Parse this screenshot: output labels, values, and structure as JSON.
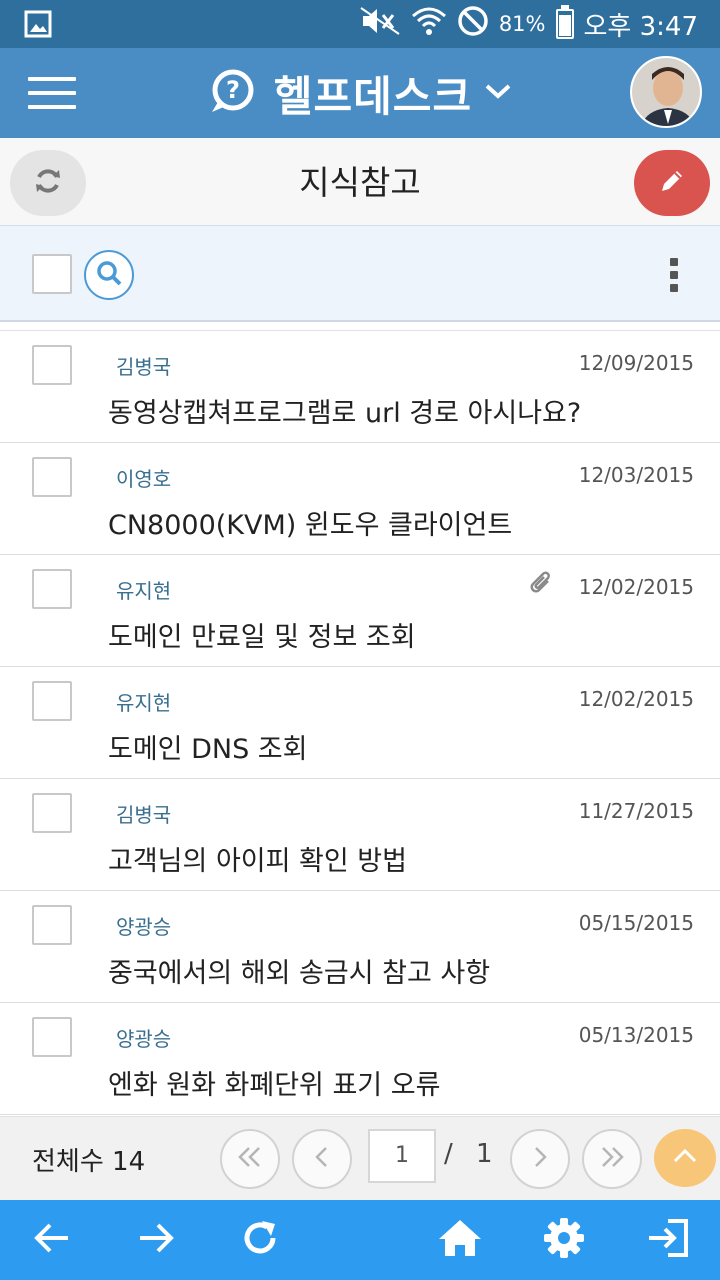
{
  "status_bar": {
    "battery_pct": "81%",
    "time": "오후 3:47",
    "battery_level": 0.81
  },
  "header": {
    "app_title": "헬프데스크"
  },
  "subheader": {
    "title": "지식참고"
  },
  "items": [
    {
      "author": "김병국",
      "date": "12/09/2015",
      "title": "동영상캡쳐프로그램로 url 경로 아시나요?",
      "attachment": false
    },
    {
      "author": "이영호",
      "date": "12/03/2015",
      "title": "CN8000(KVM) 윈도우 클라이언트",
      "attachment": false
    },
    {
      "author": "유지현",
      "date": "12/02/2015",
      "title": "도메인 만료일 및 정보 조회",
      "attachment": true
    },
    {
      "author": "유지현",
      "date": "12/02/2015",
      "title": "도메인 DNS 조회",
      "attachment": false
    },
    {
      "author": "김병국",
      "date": "11/27/2015",
      "title": "고객님의 아이피 확인 방법",
      "attachment": false
    },
    {
      "author": "양광승",
      "date": "05/15/2015",
      "title": "중국에서의 해외 송금시 참고 사항",
      "attachment": false
    },
    {
      "author": "양광승",
      "date": "05/13/2015",
      "title": "엔화 원화 화폐단위 표기 오류",
      "attachment": false
    }
  ],
  "pager": {
    "total_label": "전체수 14",
    "current_page": "1",
    "separator": "/",
    "total_pages": "1"
  },
  "colors": {
    "status_bar": "#2f6f9e",
    "header": "#4a8cc4",
    "edit_button": "#d9534f",
    "bottom_nav": "#2d9bef",
    "scroll_top": "#f7c678"
  },
  "icons": [
    "gallery-icon",
    "mute-icon",
    "wifi-icon",
    "no-sign-icon",
    "battery-icon",
    "menu-icon",
    "help-icon",
    "chevron-down-icon",
    "refresh-icon",
    "pencil-icon",
    "search-icon",
    "more-vertical-icon",
    "paperclip-icon",
    "first-page-icon",
    "prev-page-icon",
    "next-page-icon",
    "last-page-icon",
    "chevron-up-icon",
    "arrow-left-icon",
    "arrow-right-icon",
    "reload-icon",
    "home-icon",
    "gear-icon",
    "logout-icon"
  ]
}
